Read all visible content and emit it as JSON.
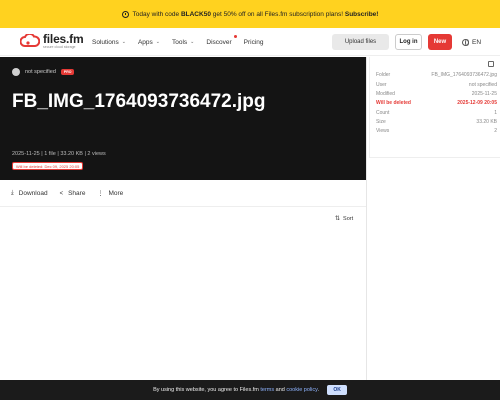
{
  "promo": {
    "prefix": "Today with code ",
    "code": "BLACK50",
    "middle": " get 50% off on all Files.fm subscription plans! ",
    "cta": "Subscribe!"
  },
  "brand": {
    "name": "files.fm",
    "tagline": "secure cloud storage",
    "accent": "#e53935"
  },
  "nav": {
    "items": [
      {
        "label": "Solutions",
        "has_dropdown": true
      },
      {
        "label": "Apps",
        "has_dropdown": true
      },
      {
        "label": "Tools",
        "has_dropdown": true
      },
      {
        "label": "Discover",
        "has_dropdown": false,
        "dot": true
      },
      {
        "label": "Pricing",
        "has_dropdown": false
      }
    ],
    "upload_label": "Upload files",
    "login_label": "Log in",
    "new_label": "New",
    "language": "EN"
  },
  "file": {
    "owner": "not specified",
    "owner_badge": "PRO",
    "title": "FB_IMG_1764093736472.jpg",
    "meta": "2025-11-25 | 1 file | 33.20 KB | 2 views",
    "deleted_notice": "Will be deleted: Dec 09, 2025 20:05"
  },
  "actions": {
    "download": "Download",
    "share": "Share",
    "more": "More",
    "sort": "Sort"
  },
  "details": [
    {
      "key": "Folder",
      "value": "FB_IMG_1764093736472.jpg",
      "warn": false
    },
    {
      "key": "User",
      "value": "not specified",
      "warn": false
    },
    {
      "key": "Modified",
      "value": "2025-11-25",
      "warn": false
    },
    {
      "key": "Will be deleted",
      "value": "2025-12-09 20:05",
      "warn": true
    },
    {
      "key": "Count",
      "value": "1",
      "warn": false
    },
    {
      "key": "Size",
      "value": "33.20 KB",
      "warn": false
    },
    {
      "key": "Views",
      "value": "2",
      "warn": false
    }
  ],
  "cookie": {
    "text": "By using this website, you agree to Files.fm ",
    "terms": "terms",
    "and": " and ",
    "policy": "cookie policy",
    "end": ".",
    "ok": "OK"
  },
  "icons": {
    "promo": "clock-icon",
    "lang": "globe-icon",
    "download": "download-icon",
    "share": "share-icon",
    "more": "more-icon",
    "sort": "sort-icon",
    "external": "external-link-icon"
  }
}
